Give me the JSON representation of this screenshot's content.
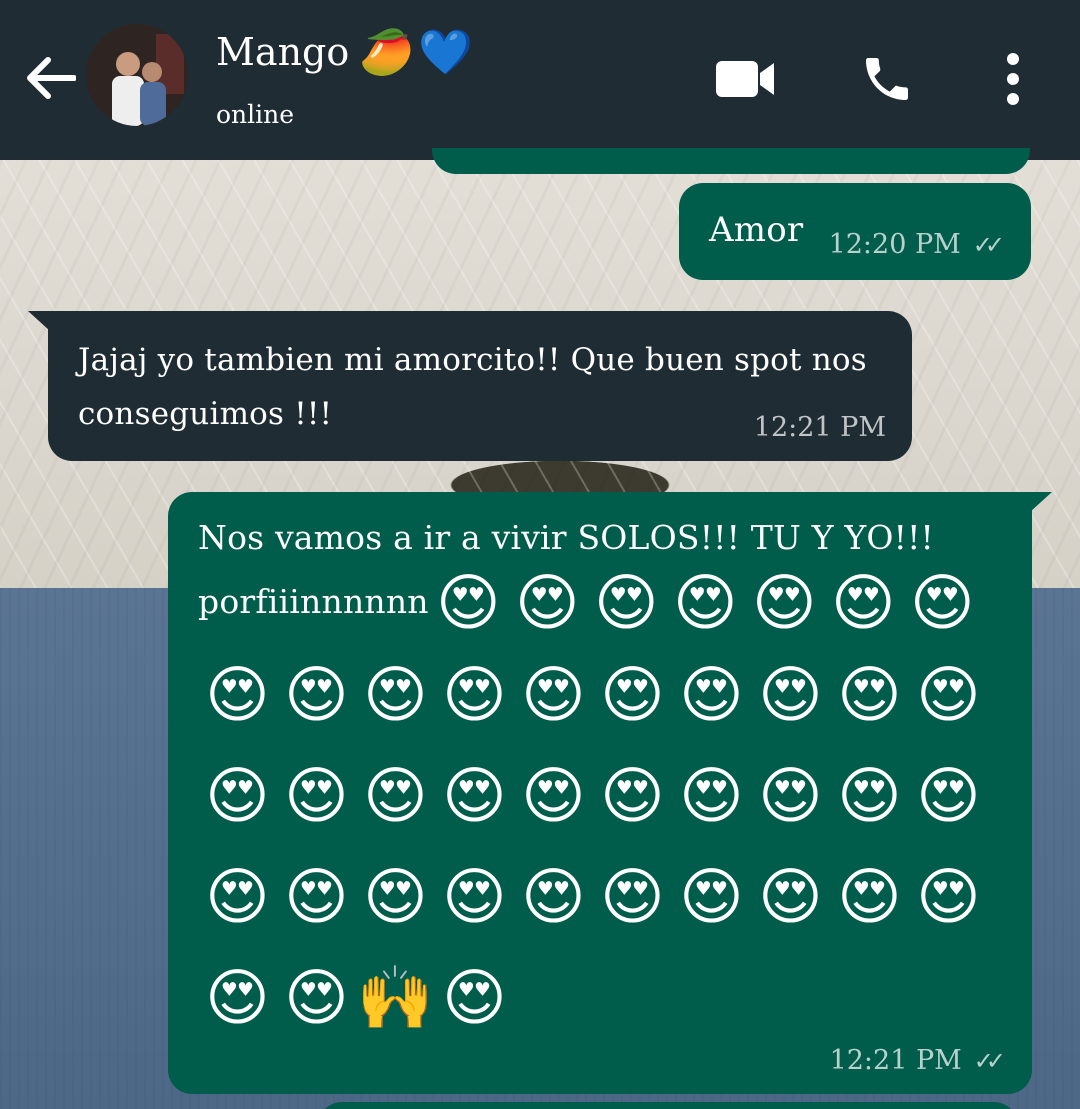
{
  "header": {
    "contact_name": "Mango",
    "name_emojis": [
      "🥭",
      "💙"
    ],
    "status": "online",
    "icons": [
      "back-arrow-icon",
      "video-call-icon",
      "voice-call-icon",
      "more-options-icon"
    ]
  },
  "messages": [
    {
      "direction": "outgoing",
      "text": "Amor",
      "time": "12:20 PM",
      "read_receipt": "✓✓"
    },
    {
      "direction": "incoming",
      "text_line1": "Jajaj yo tambien mi amorcito!! Que buen spot nos",
      "text_line2": "conseguimos !!!",
      "time": "12:21 PM"
    },
    {
      "direction": "outgoing",
      "text_line1": "Nos vamos a ir a vivir SOLOS!!! TU Y YO!!!",
      "text_line2_prefix": "porfiiinnnnnn",
      "emoji_heart_eyes": "😍",
      "emoji_raised_hands": "🙌",
      "emoji_row1_count": 7,
      "emoji_row_full_count": 10,
      "emoji_last_row": [
        "😍",
        "😍",
        "🙌",
        "😍"
      ],
      "time": "12:21 PM",
      "read_receipt": "✓✓"
    }
  ],
  "colors": {
    "header_bg": "#1f2c34",
    "outgoing_bubble": "#005c4b",
    "incoming_bubble": "#1f2c34",
    "text": "#ffffff",
    "meta_text": "#b8c7c4"
  }
}
